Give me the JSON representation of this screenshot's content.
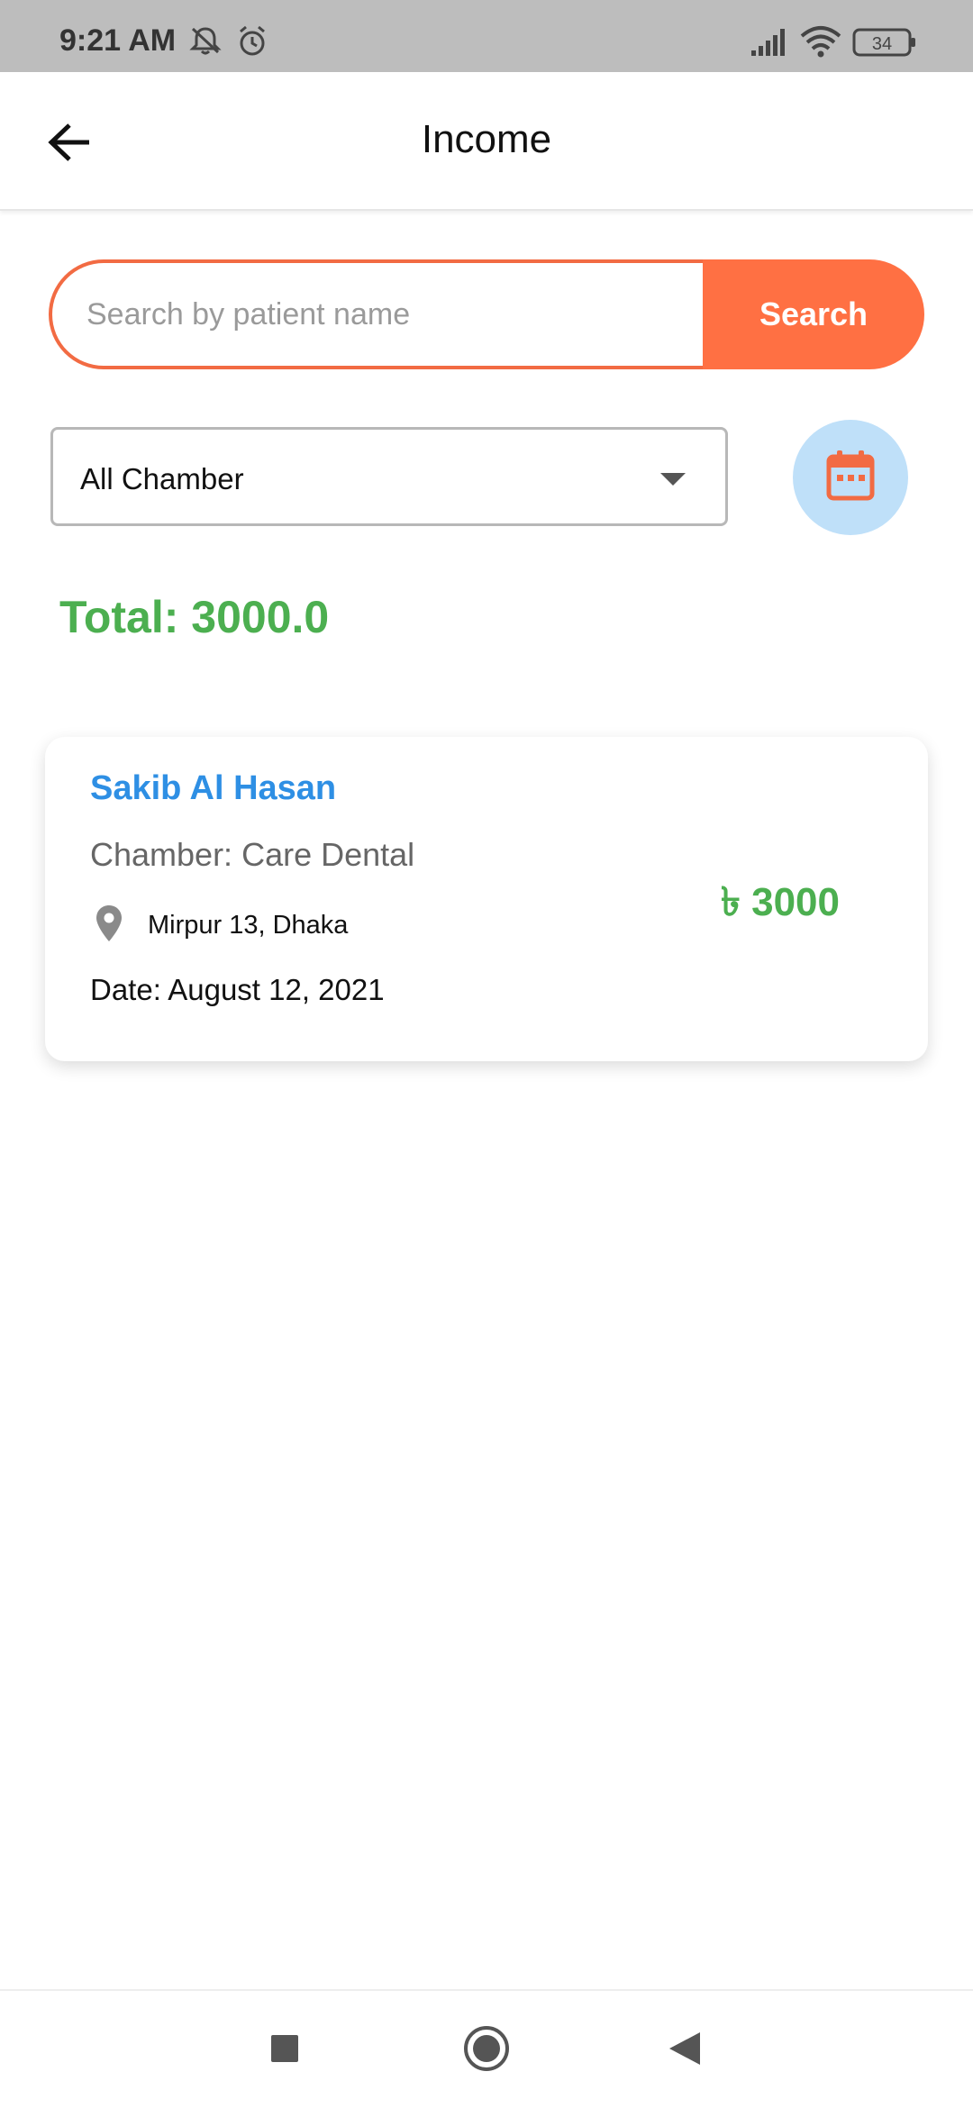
{
  "status_bar": {
    "time": "9:21 AM",
    "battery": "34",
    "icons": [
      "mute-bell-icon",
      "alarm-icon",
      "signal-icon",
      "wifi-icon",
      "battery-icon"
    ]
  },
  "app_bar": {
    "title": "Income",
    "back_icon": "arrow-left-icon"
  },
  "search": {
    "placeholder": "Search by patient name",
    "value": "",
    "button_label": "Search"
  },
  "filter": {
    "chamber_selected": "All Chamber",
    "calendar_icon": "calendar-icon"
  },
  "total_label": "Total: 3000.0",
  "entries": [
    {
      "patient": "Sakib Al Hasan",
      "chamber": "Chamber: Care Dental",
      "location": "Mirpur 13, Dhaka",
      "date": "Date: August 12, 2021",
      "amount": "৳ 3000"
    }
  ],
  "colors": {
    "accent": "#ff7043",
    "total_green": "#4caf50",
    "patient_blue": "#2e8fe4",
    "calendar_bg": "#bfe0f9"
  },
  "nav_bar": {
    "icons": [
      "recent-apps-icon",
      "home-icon",
      "back-icon"
    ]
  }
}
